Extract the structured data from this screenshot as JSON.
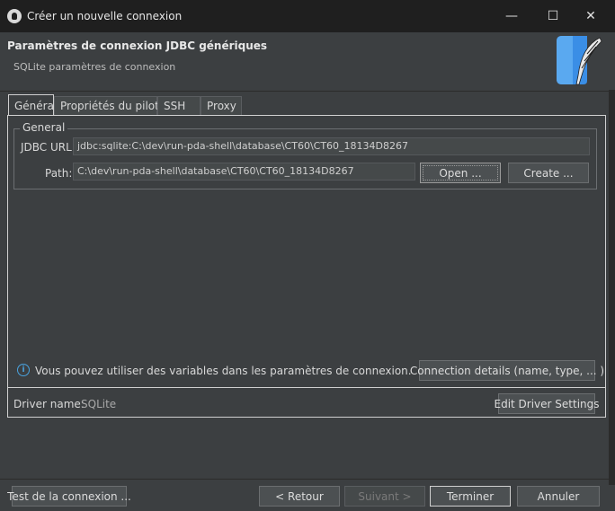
{
  "window": {
    "title": "Créer un nouvelle connexion",
    "minimize": "—",
    "maximize": "☐",
    "close": "✕"
  },
  "header": {
    "title": "Paramètres de connexion JDBC génériques",
    "subtitle": "SQLite paramètres de connexion"
  },
  "tabs": [
    {
      "label": "Général"
    },
    {
      "label": "Propriétés du pilote"
    },
    {
      "label": "SSH"
    },
    {
      "label": "Proxy"
    }
  ],
  "general": {
    "group_label": "General",
    "jdbc_url_label": "JDBC URL:",
    "jdbc_url_value": "jdbc:sqlite:C:\\dev\\run-pda-shell\\database\\CT60\\CT60_18134D8267",
    "path_label": "Path:",
    "path_value": "C:\\dev\\run-pda-shell\\database\\CT60\\CT60_18134D8267",
    "open_button": "Open ...",
    "create_button": "Create ..."
  },
  "info": {
    "text": "Vous pouvez utiliser des variables dans les paramètres de connexion.",
    "connection_details_button": "Connection details (name, type, ... )"
  },
  "driver": {
    "label": "Driver name:",
    "value": "SQLite",
    "edit_button": "Edit Driver Settings"
  },
  "footer": {
    "test_button": "Test de la connexion ...",
    "back_button": "< Retour",
    "next_button": "Suivant >",
    "finish_button": "Terminer",
    "cancel_button": "Annuler"
  },
  "colors": {
    "background": "#3c3f41",
    "titlebar": "#1f1f1f",
    "info_icon": "#4aa3df",
    "logo": "#3a8ee6"
  }
}
